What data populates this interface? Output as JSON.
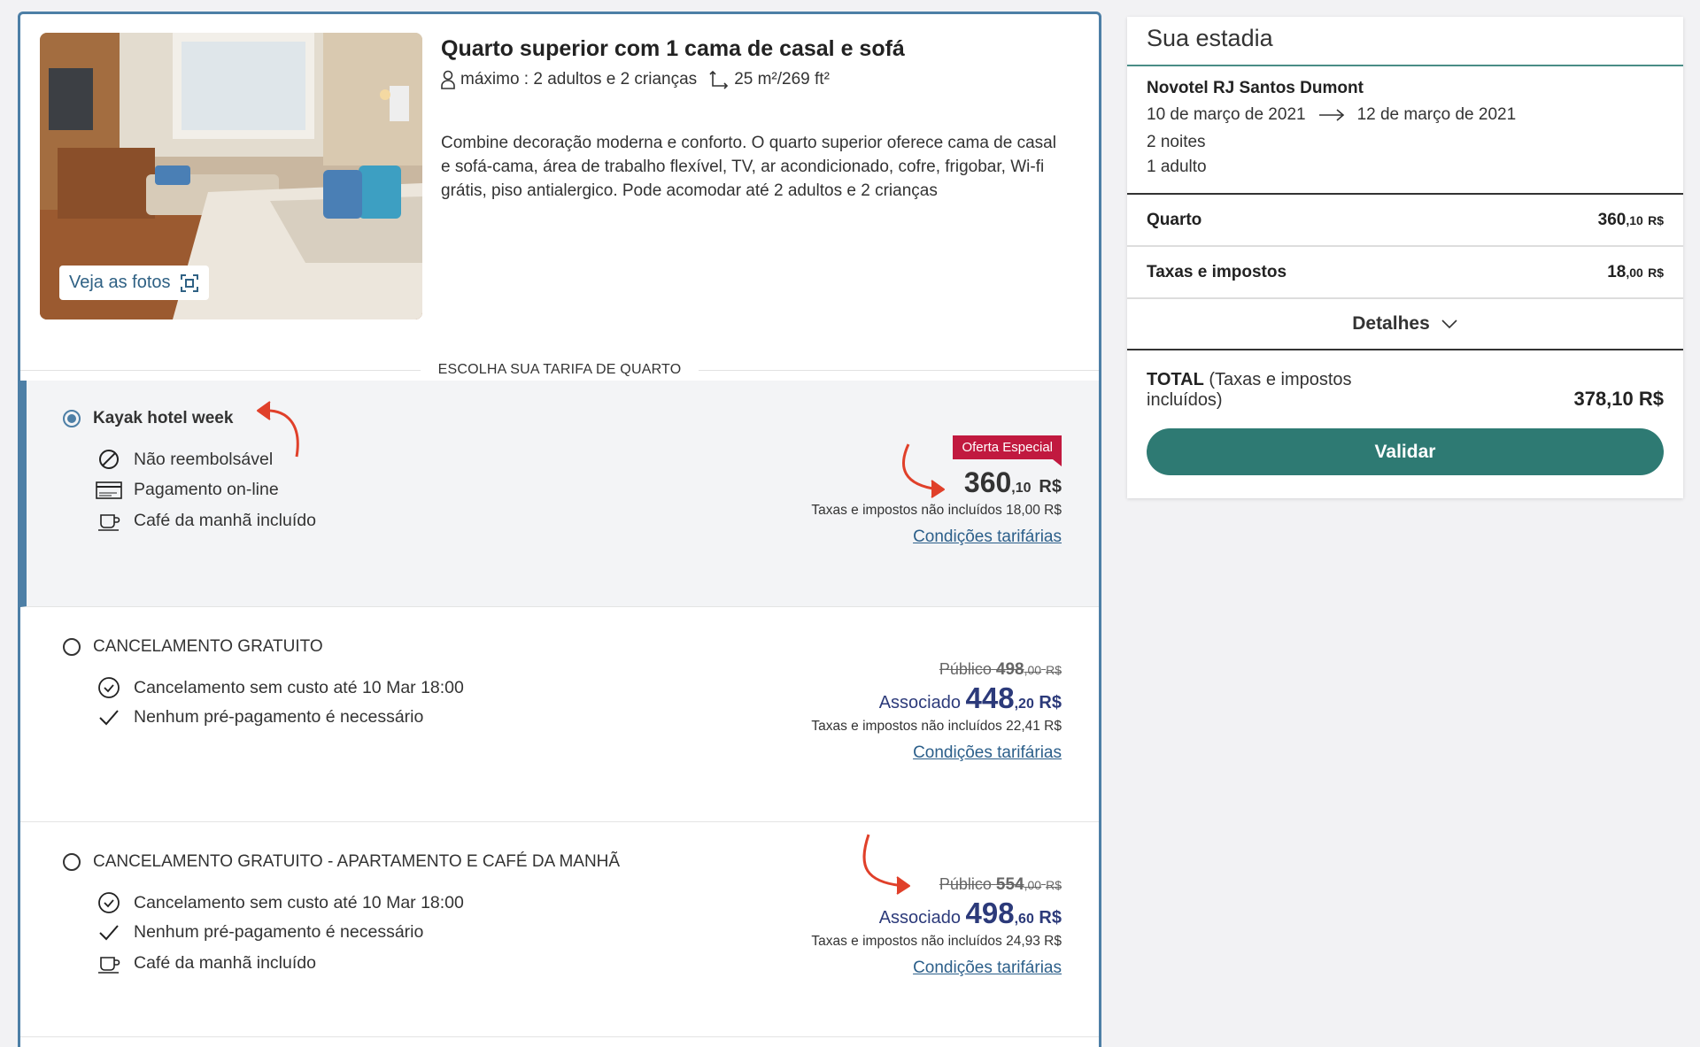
{
  "room": {
    "title": "Quarto superior com 1 cama de casal e sofá",
    "capacity": "máximo : 2 adultos e 2 crianças",
    "size": "25 m²/269 ft²",
    "description": "Combine decoração moderna e conforto. O quarto superior oferece cama de casal e sofá-cama, área de trabalho flexível, TV, ar acondicionado, cofre, frigobar, Wi-fi grátis, piso antialergico. Pode acomodar até 2 adultos e 2 crianças",
    "photos_button": "Veja as fotos",
    "section_label": "ESCOLHA SUA TARIFA DE QUARTO"
  },
  "rates": [
    {
      "name": "Kayak hotel week",
      "selected": true,
      "features": [
        {
          "icon": "no-refund-icon",
          "text": "Não reembolsável"
        },
        {
          "icon": "credit-card-icon",
          "text": "Pagamento on-line"
        },
        {
          "icon": "coffee-cup-icon",
          "text": "Café da manhã incluído"
        }
      ],
      "badge": "Oferta Especial",
      "price_int": "360",
      "price_dec": ",10",
      "currency": "R$",
      "tax_note": "Taxas e impostos não incluídos 18,00 R$",
      "conditions": "Condições tarifárias"
    },
    {
      "name": "CANCELAMENTO GRATUITO",
      "selected": false,
      "features": [
        {
          "icon": "clock-check-icon",
          "text": "Cancelamento sem custo até 10 Mar 18:00"
        },
        {
          "icon": "checkmark-icon",
          "text": "Nenhum pré-pagamento é necessário"
        }
      ],
      "public_label": "Público",
      "public_int": "498",
      "public_dec": ",00",
      "member_label": "Associado",
      "member_int": "448",
      "member_dec": ",20",
      "currency": "R$",
      "tax_note": "Taxas e impostos não incluídos 22,41 R$",
      "conditions": "Condições tarifárias"
    },
    {
      "name": "CANCELAMENTO GRATUITO - APARTAMENTO E CAFÉ DA MANHÃ",
      "selected": false,
      "features": [
        {
          "icon": "clock-check-icon",
          "text": "Cancelamento sem custo até 10 Mar 18:00"
        },
        {
          "icon": "checkmark-icon",
          "text": "Nenhum pré-pagamento é necessário"
        },
        {
          "icon": "coffee-cup-icon",
          "text": "Café da manhã incluído"
        }
      ],
      "public_label": "Público",
      "public_int": "554",
      "public_dec": ",00",
      "member_label": "Associado",
      "member_int": "498",
      "member_dec": ",60",
      "currency": "R$",
      "tax_note": "Taxas e impostos não incluídos 24,93 R$",
      "conditions": "Condições tarifárias"
    }
  ],
  "summary": {
    "title": "Sua estadia",
    "hotel": "Novotel RJ Santos Dumont",
    "checkin": "10 de março de 2021",
    "checkout": "12 de março de 2021",
    "nights": "2 noites",
    "guests": "1 adulto",
    "room_label": "Quarto",
    "room_int": "360",
    "room_dec": ",10",
    "tax_label": "Taxas e impostos",
    "tax_int": "18",
    "tax_dec": ",00",
    "currency": "R$",
    "details": "Detalhes",
    "total_label": "TOTAL",
    "total_sub": "(Taxas e impostos incluídos)",
    "total_amount": "378,10 R$",
    "validate": "Validar"
  },
  "colors": {
    "accent": "#4d7fa6",
    "badge": "#c1193f",
    "member_price": "#2c3a7a",
    "validate_button": "#2e7a73",
    "annotation_arrow": "#e0402a"
  }
}
